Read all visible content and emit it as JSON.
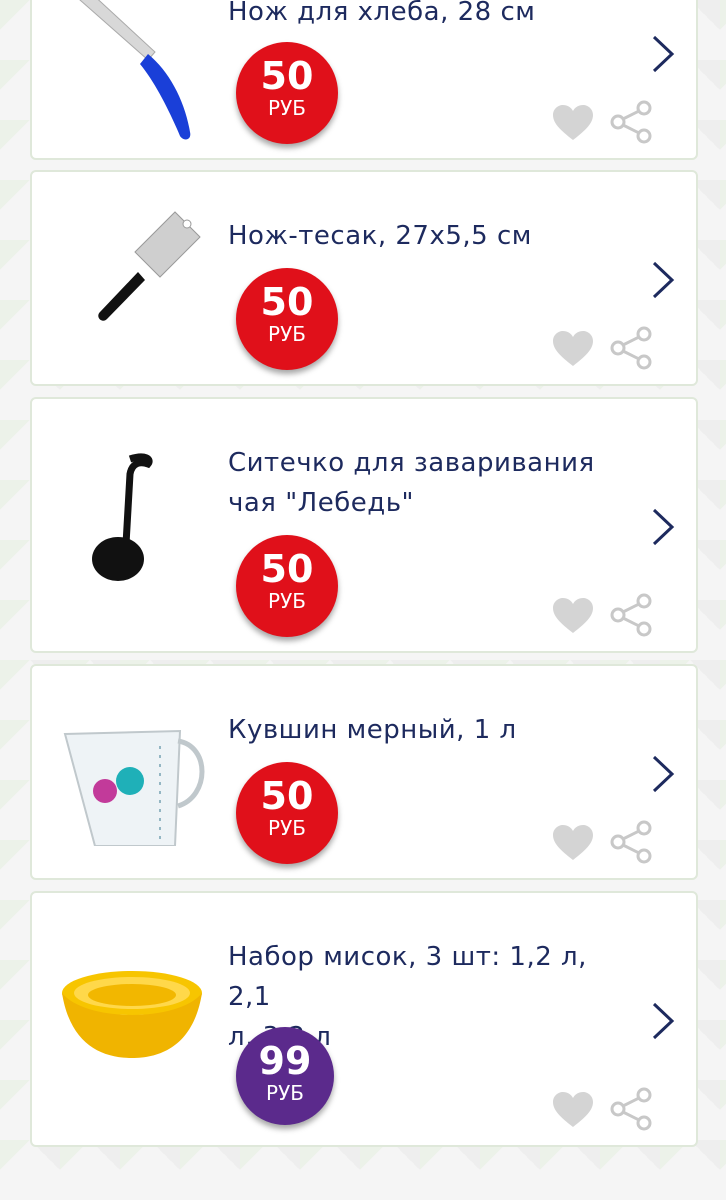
{
  "products": [
    {
      "title": "Нож для хлеба, 28 см",
      "price": "50",
      "currency": "РУБ",
      "price_color": "#e0101a",
      "image": "bread-knife-image"
    },
    {
      "title": "Нож-тесак, 27х5,5 см",
      "price": "50",
      "currency": "РУБ",
      "price_color": "#e0101a",
      "image": "cleaver-knife-image"
    },
    {
      "title_line1": "Ситечко для заваривания",
      "title_line2": "чая \"Лебедь\"",
      "price": "50",
      "currency": "РУБ",
      "price_color": "#e0101a",
      "image": "swan-tea-strainer-image"
    },
    {
      "title": "Кувшин мерный, 1 л",
      "price": "50",
      "currency": "РУБ",
      "price_color": "#e0101a",
      "image": "measuring-jug-image"
    },
    {
      "title_line1": "Набор мисок, 3 шт: 1,2 л, 2,1",
      "title_line2": "л, 3,2 л",
      "price": "99",
      "currency": "РУБ",
      "price_color": "#5b2a8c",
      "image": "bowl-set-image"
    }
  ],
  "icons": {
    "next": "chevron-right-icon",
    "favorite": "heart-icon",
    "share": "share-icon"
  }
}
